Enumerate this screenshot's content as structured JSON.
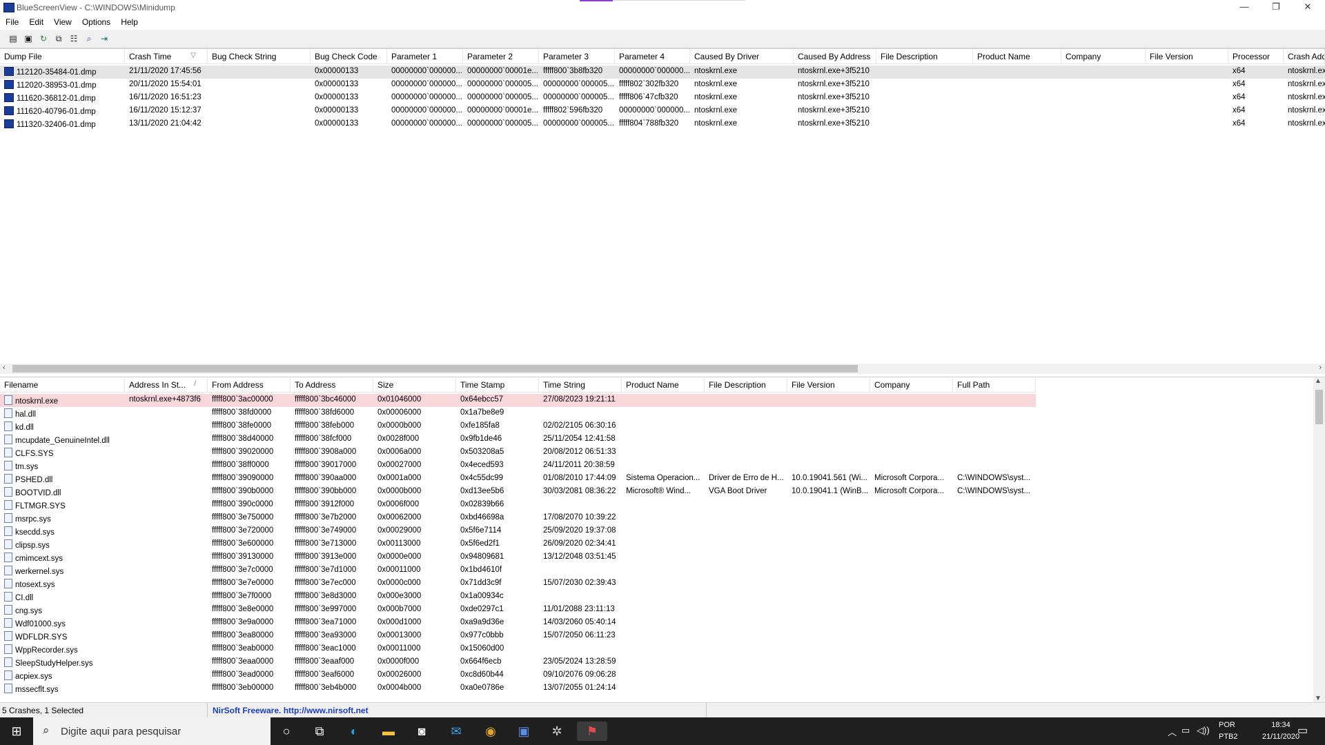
{
  "window": {
    "title": "BlueScreenView - C:\\WINDOWS\\Minidump",
    "btn_min": "—",
    "btn_restore": "❐",
    "btn_close": "✕"
  },
  "menu": [
    "File",
    "Edit",
    "View",
    "Options",
    "Help"
  ],
  "toolbar_icons": [
    "properties-icon",
    "save-icon",
    "refresh-icon",
    "copy-icon",
    "options-icon",
    "find-icon",
    "exit-icon"
  ],
  "top_table": {
    "columns": [
      "Dump File",
      "Crash Time",
      "Bug Check String",
      "Bug Check Code",
      "Parameter 1",
      "Parameter 2",
      "Parameter 3",
      "Parameter 4",
      "Caused By Driver",
      "Caused By Address",
      "File Description",
      "Product Name",
      "Company",
      "File Version",
      "Processor",
      "Crash Address"
    ],
    "sort_indicator": "▽",
    "rows": [
      [
        "112120-35484-01.dmp",
        "21/11/2020 17:45:56",
        "",
        "0x00000133",
        "00000000`000000...",
        "00000000`00001e...",
        "fffff800`3b8fb320",
        "00000000`000000...",
        "ntoskrnl.exe",
        "ntoskrnl.exe+3f5210",
        "",
        "",
        "",
        "",
        "x64",
        "ntoskrnl.exe"
      ],
      [
        "112020-38953-01.dmp",
        "20/11/2020 15:54:01",
        "",
        "0x00000133",
        "00000000`000000...",
        "00000000`000005...",
        "00000000`000005...",
        "fffff802`302fb320",
        "ntoskrnl.exe",
        "ntoskrnl.exe+3f5210",
        "",
        "",
        "",
        "",
        "x64",
        "ntoskrnl.exe"
      ],
      [
        "111620-36812-01.dmp",
        "16/11/2020 16:51:23",
        "",
        "0x00000133",
        "00000000`000000...",
        "00000000`000005...",
        "00000000`000005...",
        "fffff806`47cfb320",
        "ntoskrnl.exe",
        "ntoskrnl.exe+3f5210",
        "",
        "",
        "",
        "",
        "x64",
        "ntoskrnl.exe"
      ],
      [
        "111620-40796-01.dmp",
        "16/11/2020 15:12:37",
        "",
        "0x00000133",
        "00000000`000000...",
        "00000000`00001e...",
        "fffff802`596fb320",
        "00000000`000000...",
        "ntoskrnl.exe",
        "ntoskrnl.exe+3f5210",
        "",
        "",
        "",
        "",
        "x64",
        "ntoskrnl.exe"
      ],
      [
        "111320-32406-01.dmp",
        "13/11/2020 21:04:42",
        "",
        "0x00000133",
        "00000000`000000...",
        "00000000`000005...",
        "00000000`000005...",
        "fffff804`788fb320",
        "ntoskrnl.exe",
        "ntoskrnl.exe+3f5210",
        "",
        "",
        "",
        "",
        "x64",
        "ntoskrnl.exe"
      ]
    ]
  },
  "bottom_table": {
    "columns": [
      "Filename",
      "Address In St...",
      "From Address",
      "To Address",
      "Size",
      "Time Stamp",
      "Time String",
      "Product Name",
      "File Description",
      "File Version",
      "Company",
      "Full Path"
    ],
    "sort_indicator": "/",
    "rows": [
      [
        "ntoskrnl.exe",
        "ntoskrnl.exe+4873f6",
        "fffff800`3ac00000",
        "fffff800`3bc46000",
        "0x01046000",
        "0x64ebcc57",
        "27/08/2023 19:21:11",
        "",
        "",
        "",
        "",
        ""
      ],
      [
        "hal.dll",
        "",
        "fffff800`38fd0000",
        "fffff800`38fd6000",
        "0x00006000",
        "0x1a7be8e9",
        "",
        "",
        "",
        "",
        "",
        ""
      ],
      [
        "kd.dll",
        "",
        "fffff800`38fe0000",
        "fffff800`38feb000",
        "0x0000b000",
        "0xfe185fa8",
        "02/02/2105 06:30:16",
        "",
        "",
        "",
        "",
        ""
      ],
      [
        "mcupdate_GenuineIntel.dll",
        "",
        "fffff800`38d40000",
        "fffff800`38fcf000",
        "0x0028f000",
        "0x9fb1de46",
        "25/11/2054 12:41:58",
        "",
        "",
        "",
        "",
        ""
      ],
      [
        "CLFS.SYS",
        "",
        "fffff800`39020000",
        "fffff800`3908a000",
        "0x0006a000",
        "0x503208a5",
        "20/08/2012 06:51:33",
        "",
        "",
        "",
        "",
        ""
      ],
      [
        "tm.sys",
        "",
        "fffff800`38ff0000",
        "fffff800`39017000",
        "0x00027000",
        "0x4eced593",
        "24/11/2011 20:38:59",
        "",
        "",
        "",
        "",
        ""
      ],
      [
        "PSHED.dll",
        "",
        "fffff800`39090000",
        "fffff800`390aa000",
        "0x0001a000",
        "0x4c55dc99",
        "01/08/2010 17:44:09",
        "Sistema Operacion...",
        "Driver de Erro de H...",
        "10.0.19041.561 (Wi...",
        "Microsoft Corpora...",
        "C:\\WINDOWS\\syst..."
      ],
      [
        "BOOTVID.dll",
        "",
        "fffff800`390b0000",
        "fffff800`390bb000",
        "0x0000b000",
        "0xd13ee5b6",
        "30/03/2081 08:36:22",
        "Microsoft® Wind...",
        "VGA Boot Driver",
        "10.0.19041.1 (WinB...",
        "Microsoft Corpora...",
        "C:\\WINDOWS\\syst..."
      ],
      [
        "FLTMGR.SYS",
        "",
        "fffff800`390c0000",
        "fffff800`3912f000",
        "0x0006f000",
        "0x02839b66",
        "",
        "",
        "",
        "",
        "",
        ""
      ],
      [
        "msrpc.sys",
        "",
        "fffff800`3e750000",
        "fffff800`3e7b2000",
        "0x00062000",
        "0xbd46698a",
        "17/08/2070 10:39:22",
        "",
        "",
        "",
        "",
        ""
      ],
      [
        "ksecdd.sys",
        "",
        "fffff800`3e720000",
        "fffff800`3e749000",
        "0x00029000",
        "0x5f6e7114",
        "25/09/2020 19:37:08",
        "",
        "",
        "",
        "",
        ""
      ],
      [
        "clipsp.sys",
        "",
        "fffff800`3e600000",
        "fffff800`3e713000",
        "0x00113000",
        "0x5f6ed2f1",
        "26/09/2020 02:34:41",
        "",
        "",
        "",
        "",
        ""
      ],
      [
        "cmimcext.sys",
        "",
        "fffff800`39130000",
        "fffff800`3913e000",
        "0x0000e000",
        "0x94809681",
        "13/12/2048 03:51:45",
        "",
        "",
        "",
        "",
        ""
      ],
      [
        "werkernel.sys",
        "",
        "fffff800`3e7c0000",
        "fffff800`3e7d1000",
        "0x00011000",
        "0x1bd4610f",
        "",
        "",
        "",
        "",
        "",
        ""
      ],
      [
        "ntosext.sys",
        "",
        "fffff800`3e7e0000",
        "fffff800`3e7ec000",
        "0x0000c000",
        "0x71dd3c9f",
        "15/07/2030 02:39:43",
        "",
        "",
        "",
        "",
        ""
      ],
      [
        "CI.dll",
        "",
        "fffff800`3e7f0000",
        "fffff800`3e8d3000",
        "0x000e3000",
        "0x1a00934c",
        "",
        "",
        "",
        "",
        "",
        ""
      ],
      [
        "cng.sys",
        "",
        "fffff800`3e8e0000",
        "fffff800`3e997000",
        "0x000b7000",
        "0xde0297c1",
        "11/01/2088 23:11:13",
        "",
        "",
        "",
        "",
        ""
      ],
      [
        "Wdf01000.sys",
        "",
        "fffff800`3e9a0000",
        "fffff800`3ea71000",
        "0x000d1000",
        "0xa9a9d36e",
        "14/03/2060 05:40:14",
        "",
        "",
        "",
        "",
        ""
      ],
      [
        "WDFLDR.SYS",
        "",
        "fffff800`3ea80000",
        "fffff800`3ea93000",
        "0x00013000",
        "0x977c0bbb",
        "15/07/2050 06:11:23",
        "",
        "",
        "",
        "",
        ""
      ],
      [
        "WppRecorder.sys",
        "",
        "fffff800`3eab0000",
        "fffff800`3eac1000",
        "0x00011000",
        "0x15060d00",
        "",
        "",
        "",
        "",
        "",
        ""
      ],
      [
        "SleepStudyHelper.sys",
        "",
        "fffff800`3eaa0000",
        "fffff800`3eaaf000",
        "0x0000f000",
        "0x664f6ecb",
        "23/05/2024 13:28:59",
        "",
        "",
        "",
        "",
        ""
      ],
      [
        "acpiex.sys",
        "",
        "fffff800`3ead0000",
        "fffff800`3eaf6000",
        "0x00026000",
        "0xc8d60b44",
        "09/10/2076 09:06:28",
        "",
        "",
        "",
        "",
        ""
      ],
      [
        "mssecflt.sys",
        "",
        "fffff800`3eb00000",
        "fffff800`3eb4b000",
        "0x0004b000",
        "0xa0e0786e",
        "13/07/2055 01:24:14",
        "",
        "",
        "",
        "",
        ""
      ]
    ]
  },
  "status": {
    "count": "5 Crashes, 1 Selected",
    "freeware": "NirSoft Freeware.  http://www.nirsoft.net"
  },
  "taskbar": {
    "search_placeholder": "Digite aqui para pesquisar",
    "lang1": "POR",
    "lang2": "PTB2",
    "time": "18:34",
    "date": "21/11/2020"
  }
}
